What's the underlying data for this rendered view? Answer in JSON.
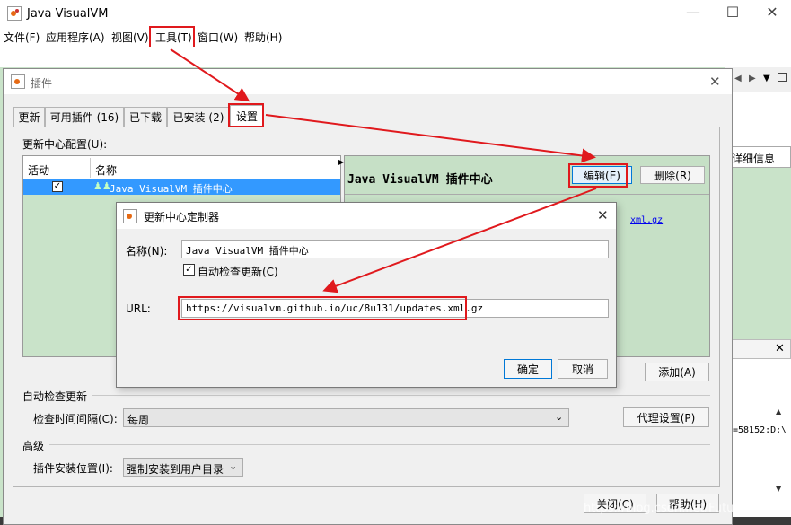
{
  "main": {
    "title": "Java VisualVM",
    "menu": [
      "文件(F)",
      "应用程序(A)",
      "视图(V)",
      "工具(T)",
      "窗口(W)",
      "帮助(H)"
    ],
    "right_panel": {
      "details_label": "详细信息",
      "console_text": "=58152:D:\\"
    }
  },
  "plugins": {
    "title": "插件",
    "tabs": [
      "更新",
      "可用插件 (16)",
      "已下载",
      "已安装 (2)",
      "设置"
    ],
    "active_tab": "设置",
    "update_center_label": "更新中心配置(U):",
    "table_headers": [
      "活动",
      "名称"
    ],
    "rows": [
      {
        "active": true,
        "name": "Java VisualVM 插件中心"
      }
    ],
    "detail_title": "Java VisualVM 插件中心",
    "edit_button": "编辑(E)",
    "delete_button": "删除(R)",
    "detail_link_suffix": "xml.gz",
    "add_button": "添加(A)",
    "auto_check_section": "自动检查更新",
    "check_interval_label": "检查时间间隔(C):",
    "check_interval_value": "每周",
    "proxy_button": "代理设置(P)",
    "advanced_section": "高级",
    "install_location_label": "插件安装位置(I):",
    "install_location_value": "强制安装到用户目录",
    "close_button": "关闭(C)",
    "help_button": "帮助(H)"
  },
  "customizer": {
    "title": "更新中心定制器",
    "name_label": "名称(N):",
    "name_value": "Java VisualVM 插件中心",
    "auto_check_label": "自动检查更新(C)",
    "auto_check_checked": true,
    "url_label": "URL:",
    "url_value": "https://visualvm.github.io/uc/8u131/updates.xml.gz",
    "ok_button": "确定",
    "cancel_button": "取消"
  },
  "watermark": "https://blog.csdn.net/Future_LL",
  "colors": {
    "annotation_red": "#e0191d",
    "detail_green": "#c6e0c6",
    "selection_blue": "#3399ff",
    "link_blue": "#0000ee"
  }
}
